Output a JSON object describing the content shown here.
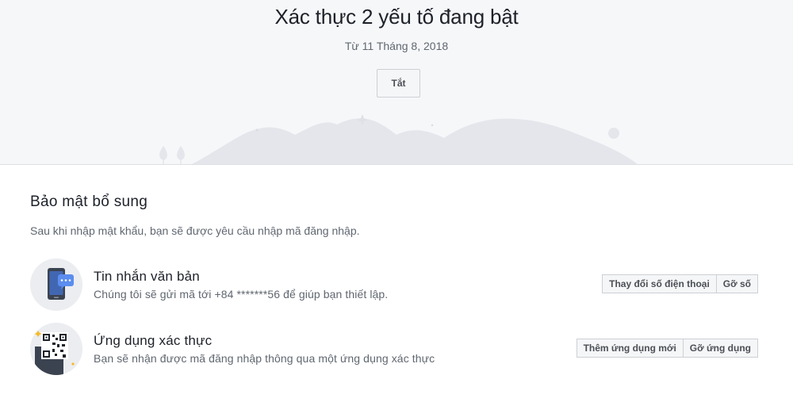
{
  "hero": {
    "title": "Xác thực 2 yếu tố đang bật",
    "date": "Từ 11 Tháng 8, 2018",
    "off_button": "Tắt"
  },
  "section": {
    "title": "Bảo mật bổ sung",
    "description": "Sau khi nhập mật khẩu, bạn sẽ được yêu cầu nhập mã đăng nhập."
  },
  "methods": [
    {
      "title": "Tin nhắn văn bản",
      "description": "Chúng tôi sẽ gửi mã tới +84 *******56 để giúp bạn thiết lập.",
      "icon": "phone-message-icon",
      "buttons": [
        "Thay đổi số điện thoại",
        "Gỡ số"
      ]
    },
    {
      "title": "Ứng dụng xác thực",
      "description": "Bạn sẽ nhận được mã đăng nhập thông qua một ứng dụng xác thực",
      "icon": "qr-code-icon",
      "buttons": [
        "Thêm ứng dụng mới",
        "Gỡ ứng dụng"
      ]
    }
  ],
  "colors": {
    "hero_background": "#f6f7f9",
    "text_primary": "#1d2129",
    "text_secondary": "#606770",
    "button_background": "#f5f6f7",
    "button_border": "#ccd0d5",
    "accent_blue": "#4267b2"
  }
}
